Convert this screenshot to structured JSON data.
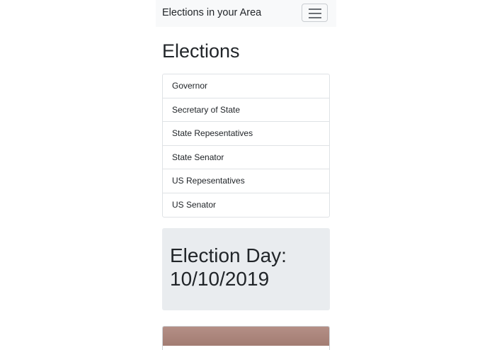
{
  "navbar": {
    "brand": "Elections in your Area",
    "toggler_icon": "hamburger-menu-icon"
  },
  "page": {
    "title": "Elections"
  },
  "elections": [
    "Governor",
    "Secretary of State",
    "State Repesentatives",
    "State Senator",
    "US Repesentatives",
    "US Senator"
  ],
  "jumbotron": {
    "line1": "Election Day:",
    "line2": "10/10/2019"
  },
  "colors": {
    "navbar_bg": "#f8f9fa",
    "jumbotron_bg": "#e9ecef",
    "border": "#dfe2e5",
    "text": "#212529"
  }
}
